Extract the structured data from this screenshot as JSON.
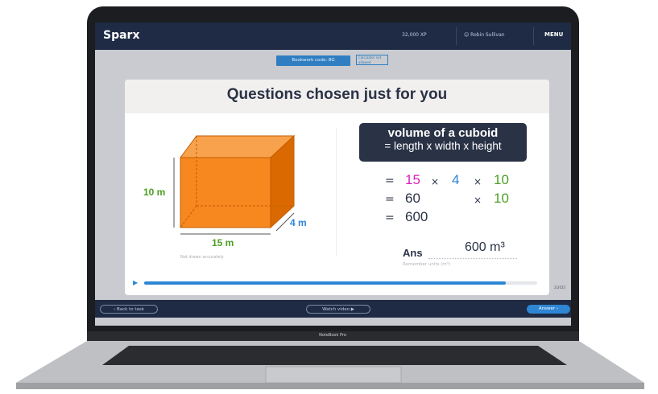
{
  "app": {
    "logo": "Sparx",
    "xp": "32,000 XP",
    "user": "Robin Sullivan",
    "menu_label": "MENU",
    "bookwork_code": "Bookwork code: 8G",
    "bookwork_badge": "Calculator not allowed"
  },
  "card": {
    "title": "Questions chosen just for you",
    "cuboid": {
      "height_label": "10 m",
      "length_label": "15 m",
      "width_label": "4 m",
      "note": "Not drawn accurately"
    },
    "formula": {
      "title": "volume of a cuboid",
      "subtitle": "= length x width x height"
    },
    "working": {
      "row1": {
        "eq": "=",
        "a": "15",
        "x1": "×",
        "b": "4",
        "x2": "×",
        "c": "10"
      },
      "row2": {
        "eq": "=",
        "a": "60",
        "x": "×",
        "b": "10"
      },
      "row3": {
        "eq": "=",
        "a": "600"
      }
    },
    "answer": {
      "label": "Ans",
      "value": "600 m³",
      "hint": "Remember units (m³)"
    },
    "progress": 0.92
  },
  "footer": {
    "back_label": "Back to task",
    "watch_label": "Watch video ▶",
    "answer_label": "Answer ›",
    "side_number": "2/2025"
  },
  "device": {
    "model": "NoteBook Pro"
  },
  "colors": {
    "navy": "#1f2b44",
    "orange": "#f7871f",
    "pink": "#d81fbe",
    "blue": "#2e86d4",
    "green": "#4b9e21"
  }
}
